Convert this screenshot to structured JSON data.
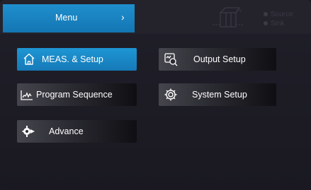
{
  "header": {
    "menu_label": "Menu",
    "chevron": "›",
    "status": [
      {
        "label": "Source",
        "color": "#3c3a45"
      },
      {
        "label": "Sink",
        "color": "#3c3a45"
      }
    ],
    "indicator_icon": "power-supply-icon"
  },
  "menu": {
    "items": [
      {
        "label": "MEAS. & Setup",
        "icon": "home-icon",
        "active": true
      },
      {
        "label": "Output Setup",
        "icon": "output-setup-icon",
        "active": false
      },
      {
        "label": "Program Sequence",
        "icon": "program-sequence-icon",
        "active": false
      },
      {
        "label": "System Setup",
        "icon": "gear-icon",
        "active": false
      },
      {
        "label": "Advance",
        "icon": "advance-gear-icon",
        "active": false
      }
    ]
  },
  "colors": {
    "accent": "#1e8fcf",
    "background": "#1b1a22",
    "button_dark": "#0f0f13"
  }
}
